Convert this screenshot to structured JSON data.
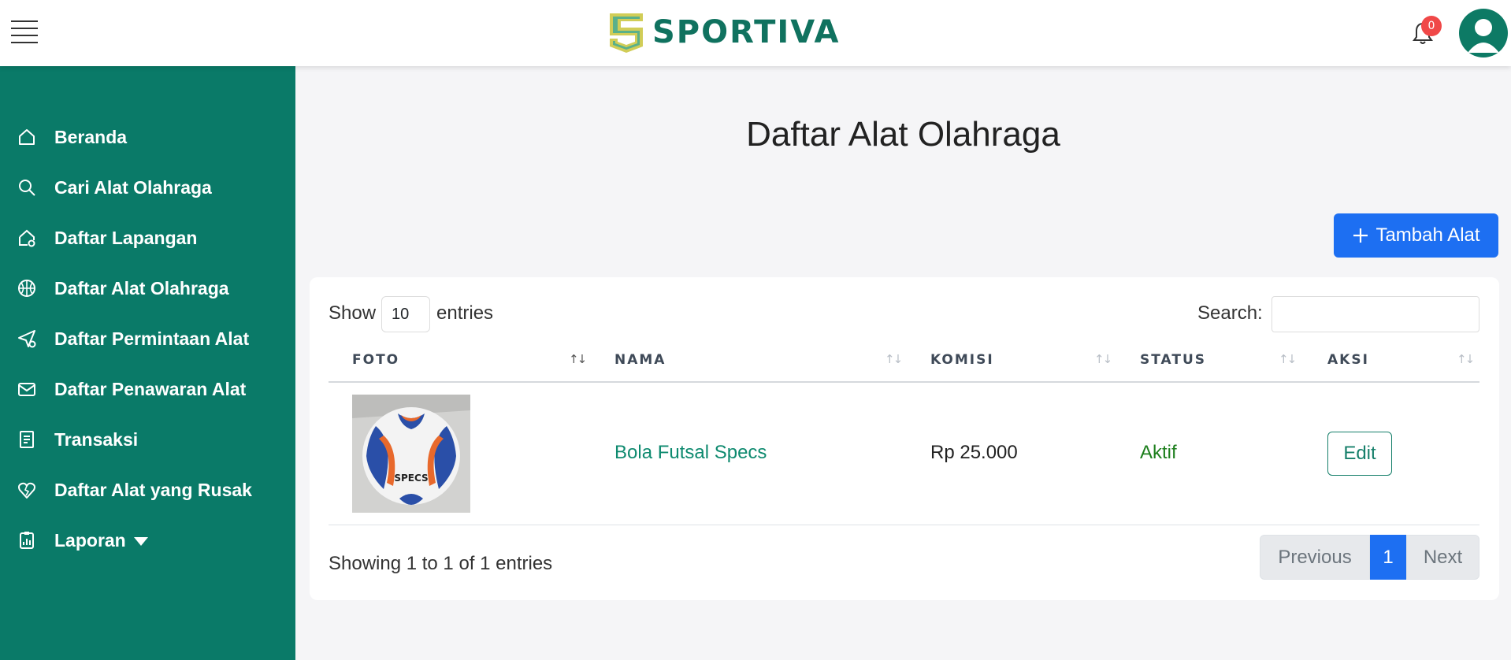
{
  "header": {
    "brand": "SPORTIVA",
    "notification_count": "0"
  },
  "sidebar": {
    "items": [
      {
        "label": "Beranda",
        "icon": "home-icon"
      },
      {
        "label": "Cari Alat Olahraga",
        "icon": "search-icon"
      },
      {
        "label": "Daftar Lapangan",
        "icon": "house-gear-icon"
      },
      {
        "label": "Daftar Alat Olahraga",
        "icon": "basketball-icon"
      },
      {
        "label": "Daftar Permintaan Alat",
        "icon": "send-gear-icon"
      },
      {
        "label": "Daftar Penawaran Alat",
        "icon": "envelope-icon"
      },
      {
        "label": "Transaksi",
        "icon": "receipt-icon"
      },
      {
        "label": "Daftar Alat yang Rusak",
        "icon": "heart-break-icon"
      },
      {
        "label": "Laporan",
        "icon": "clipboard-chart-icon"
      }
    ]
  },
  "main": {
    "title": "Daftar Alat Olahraga",
    "add_button": "Tambah Alat",
    "show_label": "Show",
    "entries_value": "10",
    "entries_label": "entries",
    "search_label": "Search:",
    "search_value": "",
    "columns": [
      "FOTO",
      "NAMA",
      "KOMISI",
      "STATUS",
      "AKSI"
    ],
    "rows": [
      {
        "nama": "Bola Futsal Specs",
        "komisi": "Rp 25.000",
        "status": "Aktif",
        "aksi": "Edit"
      }
    ],
    "info": "Showing 1 to 1 of 1 entries",
    "pagination": {
      "previous": "Previous",
      "current": "1",
      "next": "Next"
    }
  },
  "colors": {
    "sidebar": "#0a7a68",
    "primary": "#1d6ff2",
    "link": "#0e8a6f",
    "status_active": "#1d7f1d"
  }
}
